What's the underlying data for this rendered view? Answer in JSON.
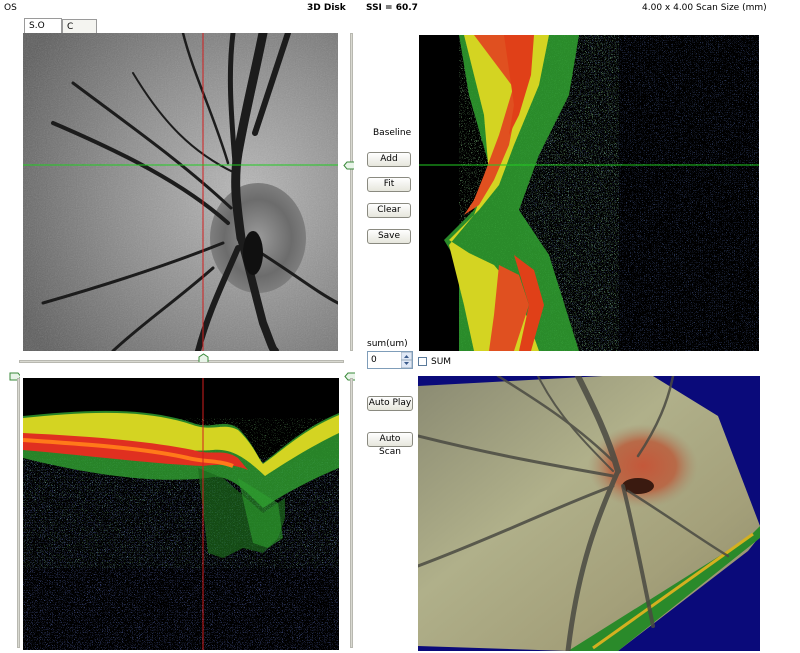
{
  "header": {
    "eye": "OS",
    "mode": "3D Disk",
    "ssi": "SSI = 60.7",
    "scan_size": "4.00 x 4.00 Scan Size (mm)"
  },
  "tabs": [
    {
      "label": "S.O",
      "active": true
    },
    {
      "label": "C Scan",
      "active": false
    }
  ],
  "controls": {
    "baseline_label": "Baseline",
    "add_label": "Add",
    "fit_label": "Fit",
    "clear_label": "Clear",
    "save_label": "Save",
    "sum_um_label": "sum(um)",
    "sum_value": "0",
    "sum_checkbox_label": "SUM",
    "auto_play_label": "Auto Play",
    "auto_scan_label": "Auto Scan"
  },
  "colors": {
    "crosshair_red": "#d21e1e",
    "crosshair_green": "#22cc22",
    "render_background": "#0a0a7a"
  }
}
